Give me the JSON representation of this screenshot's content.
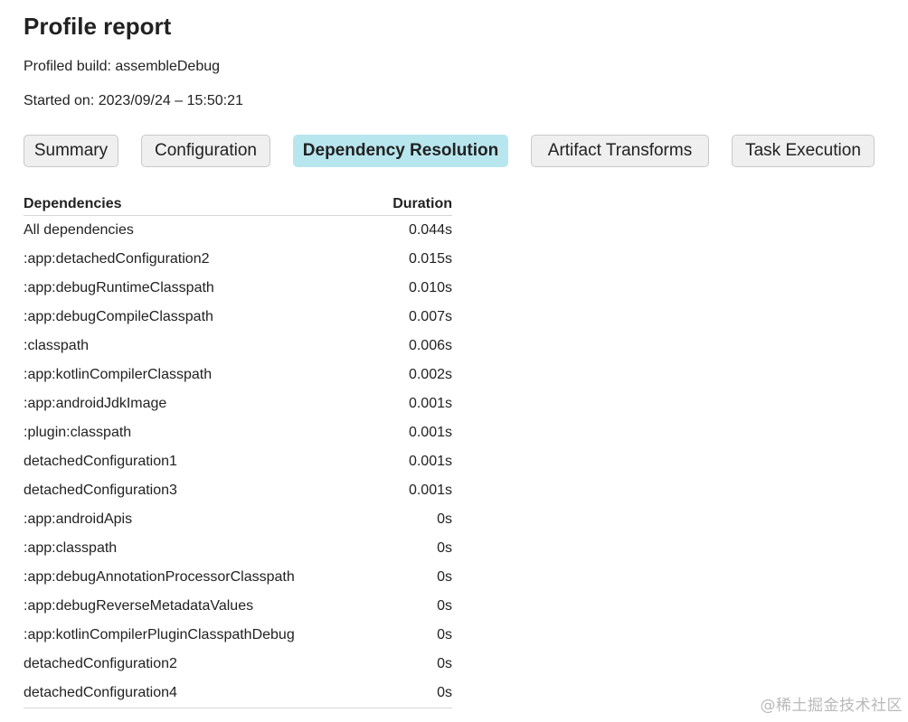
{
  "page": {
    "title": "Profile report",
    "build_line": "Profiled build: assembleDebug",
    "started_line": "Started on: 2023/09/24 – 15:50:21"
  },
  "tabs": [
    {
      "label": "Summary",
      "active": false
    },
    {
      "label": "Configuration",
      "active": false
    },
    {
      "label": "Dependency Resolution",
      "active": true
    },
    {
      "label": "Artifact Transforms",
      "active": false
    },
    {
      "label": "Task Execution",
      "active": false
    }
  ],
  "colors": {
    "active_tab": "#b8e6ee",
    "inactive_tab": "#efefef"
  },
  "table": {
    "headers": {
      "dependency": "Dependencies",
      "duration": "Duration"
    },
    "rows": [
      {
        "name": "All dependencies",
        "duration": "0.044s"
      },
      {
        "name": ":app:detachedConfiguration2",
        "duration": "0.015s"
      },
      {
        "name": ":app:debugRuntimeClasspath",
        "duration": "0.010s"
      },
      {
        "name": ":app:debugCompileClasspath",
        "duration": "0.007s"
      },
      {
        "name": ":classpath",
        "duration": "0.006s"
      },
      {
        "name": ":app:kotlinCompilerClasspath",
        "duration": "0.002s"
      },
      {
        "name": ":app:androidJdkImage",
        "duration": "0.001s"
      },
      {
        "name": ":plugin:classpath",
        "duration": "0.001s"
      },
      {
        "name": "detachedConfiguration1",
        "duration": "0.001s"
      },
      {
        "name": "detachedConfiguration3",
        "duration": "0.001s"
      },
      {
        "name": ":app:androidApis",
        "duration": "0s"
      },
      {
        "name": ":app:classpath",
        "duration": "0s"
      },
      {
        "name": ":app:debugAnnotationProcessorClasspath",
        "duration": "0s"
      },
      {
        "name": ":app:debugReverseMetadataValues",
        "duration": "0s"
      },
      {
        "name": ":app:kotlinCompilerPluginClasspathDebug",
        "duration": "0s"
      },
      {
        "name": "detachedConfiguration2",
        "duration": "0s"
      },
      {
        "name": "detachedConfiguration4",
        "duration": "0s"
      }
    ]
  },
  "watermark": "@稀土掘金技术社区"
}
